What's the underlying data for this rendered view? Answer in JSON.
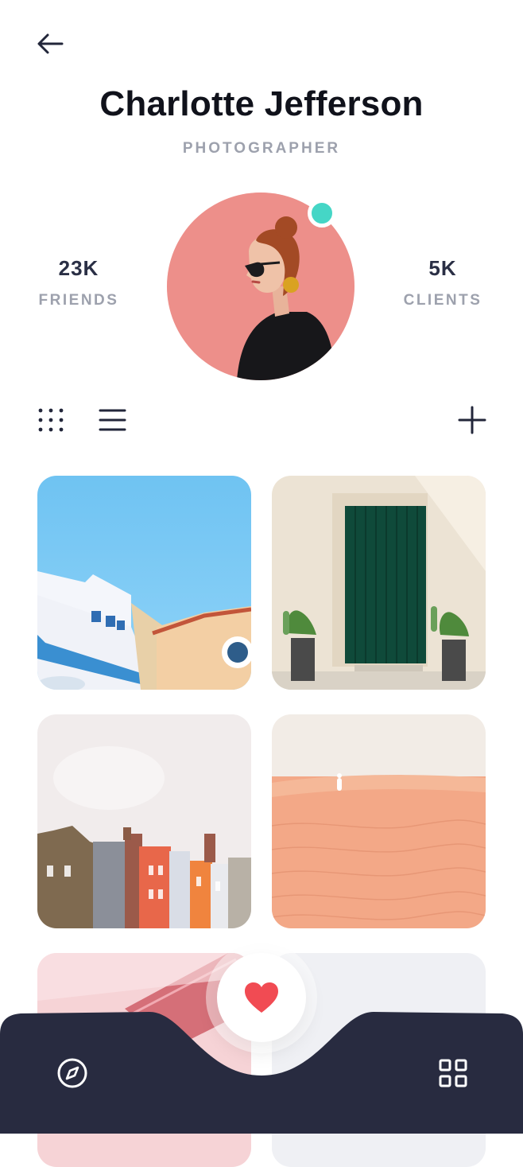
{
  "header": {
    "back_icon": "arrow-left-icon"
  },
  "profile": {
    "name": "Charlotte Jefferson",
    "role": "PHOTOGRAPHER",
    "online": true,
    "accent_color": "#45d6c6"
  },
  "stats": [
    {
      "value": "23K",
      "label": "FRIENDS"
    },
    {
      "value": "5K",
      "label": "CLIENTS"
    }
  ],
  "toolbar": {
    "grid_view_icon": "dots-grid-icon",
    "list_view_icon": "list-icon",
    "add_icon": "plus-icon"
  },
  "photos": [
    {
      "subject": "colorful-buildings-blue-sky"
    },
    {
      "subject": "green-door-with-cacti"
    },
    {
      "subject": "townhouses-rooftops"
    },
    {
      "subject": "desert-dunes-figure"
    },
    {
      "subject": "pink-architecture"
    },
    {
      "subject": "light-gray-scene"
    }
  ],
  "bottom_nav": {
    "left_icon": "compass-icon",
    "center_icon": "heart-icon",
    "right_icon": "apps-grid-icon",
    "bar_color": "#282b40",
    "heart_color": "#f14b53"
  }
}
